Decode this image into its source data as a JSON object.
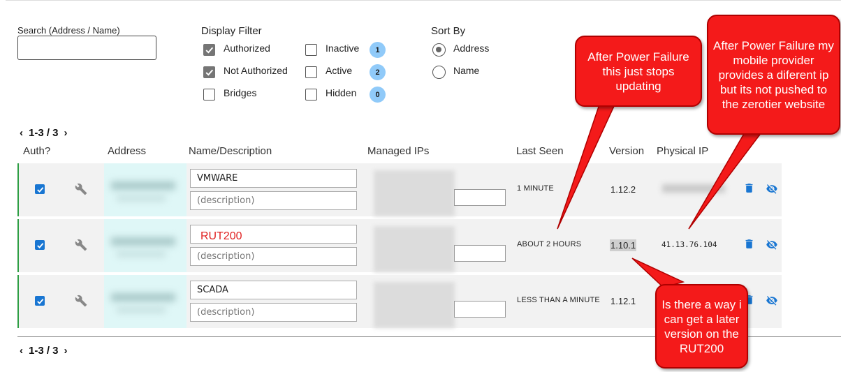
{
  "search": {
    "label": "Search (Address / Name)",
    "value": "",
    "placeholder": ""
  },
  "display_filter": {
    "title": "Display Filter",
    "options": [
      {
        "label": "Authorized",
        "checked": true
      },
      {
        "label": "Not Authorized",
        "checked": true
      },
      {
        "label": "Bridges",
        "checked": false
      },
      {
        "label": "Inactive",
        "checked": false,
        "count": "1"
      },
      {
        "label": "Active",
        "checked": false,
        "count": "2"
      },
      {
        "label": "Hidden",
        "checked": false,
        "count": "0"
      }
    ]
  },
  "sort_by": {
    "title": "Sort By",
    "options": [
      {
        "label": "Address",
        "selected": true
      },
      {
        "label": "Name",
        "selected": false
      }
    ]
  },
  "pager": {
    "range": "1-3 / 3",
    "prev_icon": "chevron-left-icon",
    "next_icon": "chevron-right-icon"
  },
  "table": {
    "headers": [
      "Auth?",
      "Address",
      "Name/Description",
      "Managed IPs",
      "Last Seen",
      "Version",
      "Physical IP"
    ],
    "rows": [
      {
        "authorized": true,
        "name": "VMWARE",
        "description_placeholder": "(description)",
        "last_seen": "1 MINUTE",
        "version": "1.12.2",
        "physical_ip": ""
      },
      {
        "authorized": true,
        "name": "",
        "description_placeholder": "(description)",
        "last_seen": "ABOUT 2 HOURS",
        "version": "1.10.1",
        "physical_ip": "41.13.76.104"
      },
      {
        "authorized": true,
        "name": "SCADA",
        "description_placeholder": "(description)",
        "last_seen": "LESS THAN A MINUTE",
        "version": "1.12.1",
        "physical_ip": ""
      }
    ]
  },
  "overlay_text": "RUT200",
  "annotations": {
    "callout_1": "After Power Failure this just stops updating",
    "callout_2": "After Power Failure my mobile provider provides a diferent ip but its not pushed to the zerotier website",
    "callout_3": "Is there a way i can get a later version on the RUT200"
  },
  "colors": {
    "accent": "#1976d2",
    "row_border": "#2e9e44",
    "badge": "#90caf9",
    "callout": "#f41a1a"
  }
}
